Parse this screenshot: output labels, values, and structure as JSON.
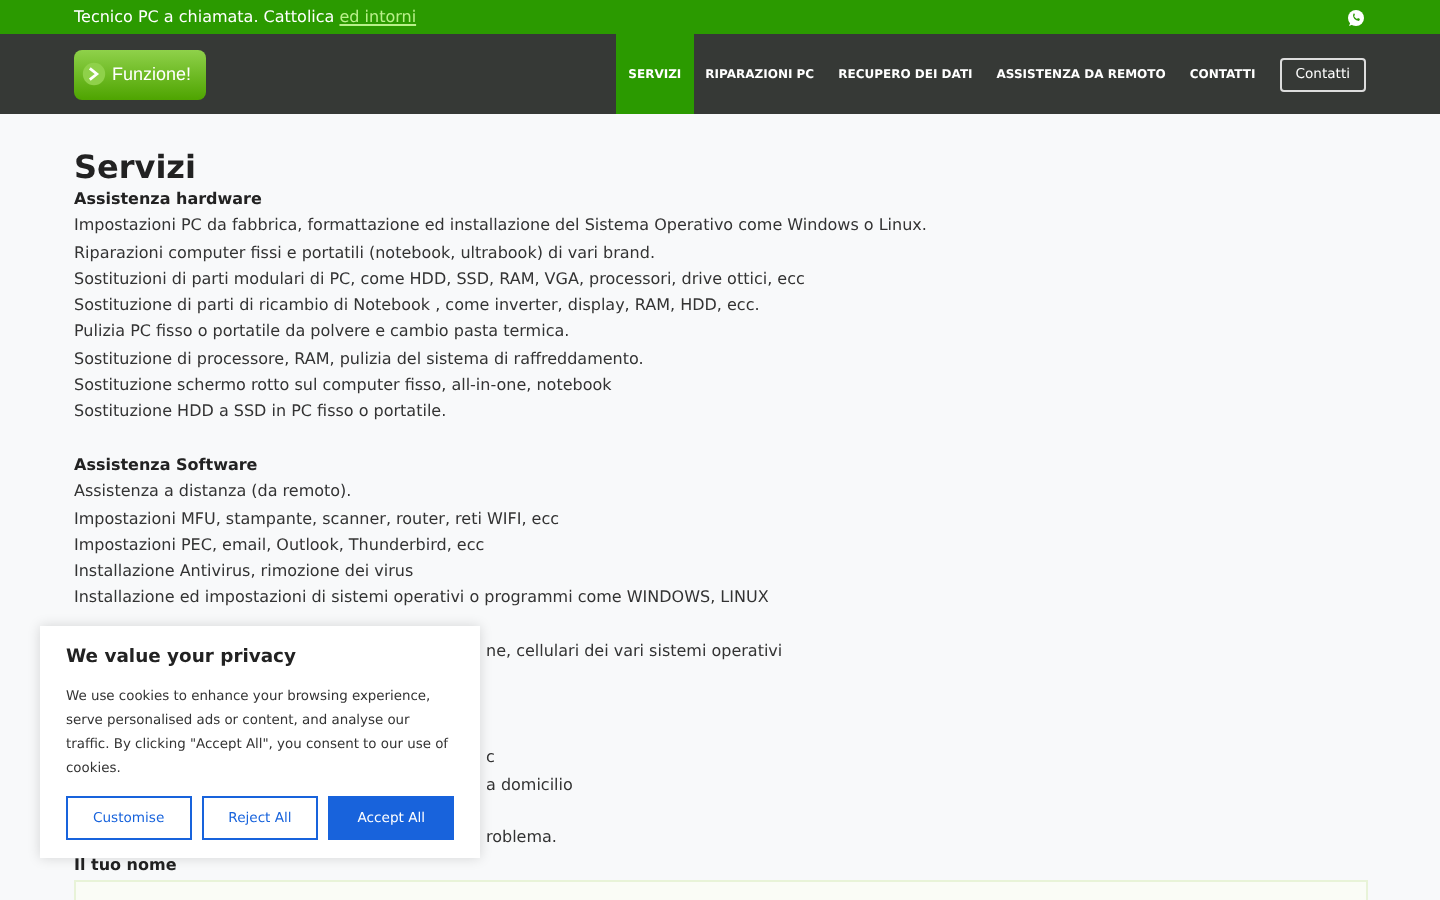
{
  "top_bar": {
    "text": "Tecnico PC a chiamata. Cattolica",
    "link": "ed intorni"
  },
  "nav": {
    "logo": "Funzione!",
    "items": [
      {
        "label": "SERVIZI",
        "selected": true
      },
      {
        "label": "RIPARAZIONI PC",
        "selected": false
      },
      {
        "label": "RECUPERO DEI DATI",
        "selected": false
      },
      {
        "label": "ASSISTENZA DA REMOTO",
        "selected": false
      },
      {
        "label": "CONTATTI",
        "selected": false
      }
    ],
    "button": "Contatti"
  },
  "content": {
    "title": "Servizi",
    "sections": [
      {
        "heading": "Assistenza hardware",
        "lines": [
          "Impostazioni PC da fabbrica, formattazione ed installazione del Sistema Operativo come Windows o Linux.",
          "Riparazioni computer fissi e portatili (notebook, ultrabook) di vari brand.",
          "Sostituzioni di parti modulari di PC, come HDD, SSD, RAM, VGA, processori, drive ottici, ecc",
          "Sostituzione di parti di ricambio di Notebook , come inverter, display, RAM, HDD, ecc.",
          "Pulizia PC fisso o portatile da polvere e cambio pasta termica.",
          "Sostituzione di processore, RAM, pulizia del sistema di raffreddamento.",
          "Sostituzione schermo rotto sul computer fisso, all-in-one, notebook",
          "Sostituzione HDD a SSD in PC fisso o portatile."
        ]
      },
      {
        "heading": "Assistenza Software",
        "lines": [
          "Assistenza a distanza (da remoto).",
          "Impostazioni MFU, stampante, scanner, router, reti WIFI, ecc",
          "Impostazioni PEC, email, Outlook, Thunderbird, ecc",
          "Installazione Antivirus, rimozione dei virus",
          "Installazione ed impostazioni di sistemi operativi o programmi come WINDOWS, LINUX"
        ]
      }
    ],
    "fragments": [
      "ne, cellulari dei vari sistemi operativi",
      "c",
      "a domicilio",
      "roblema."
    ],
    "form": {
      "label": "Il tuo nome"
    }
  },
  "cookie": {
    "title": "We value your privacy",
    "text": "We use cookies to enhance your browsing experience, serve personalised ads or content, and analyse our traffic. By clicking \"Accept All\", you consent to our use of cookies.",
    "buttons": [
      {
        "label": "Customise",
        "kind": "outline"
      },
      {
        "label": "Reject All",
        "kind": "outline"
      },
      {
        "label": "Accept All",
        "kind": "primary"
      }
    ]
  }
}
